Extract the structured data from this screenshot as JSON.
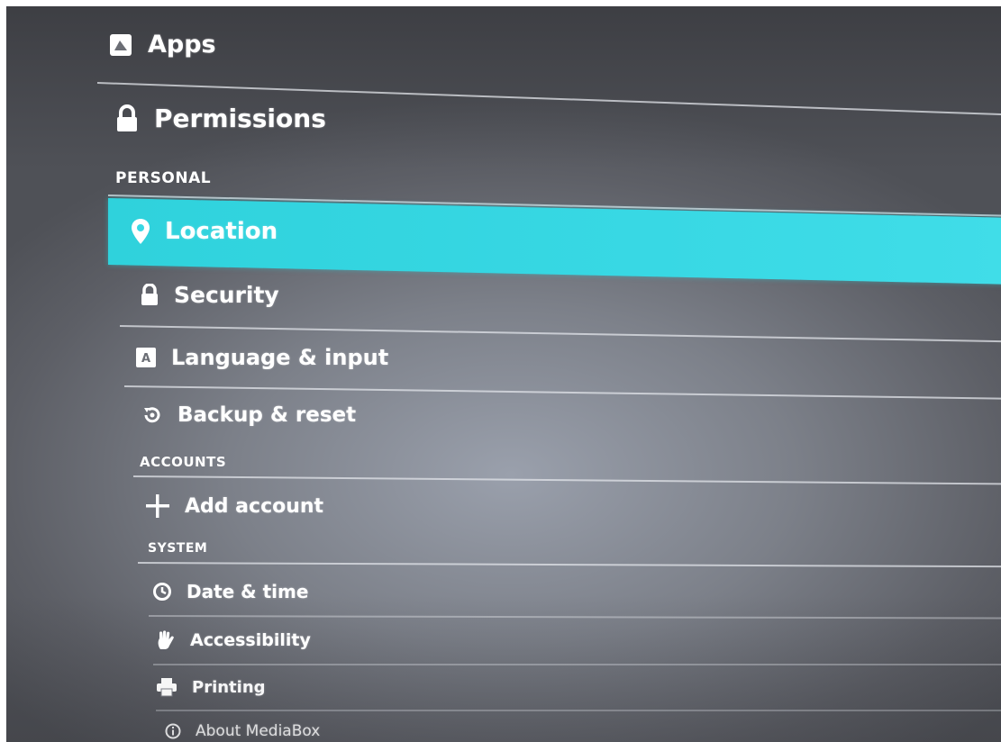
{
  "settings": {
    "apps": {
      "label": "Apps",
      "icon": "apps-icon"
    },
    "permissions": {
      "label": "Permissions",
      "icon": "lock-icon"
    },
    "sections": {
      "personal": "PERSONAL",
      "accounts": "ACCOUNTS",
      "system": "SYSTEM"
    },
    "location": {
      "label": "Location",
      "icon": "location-pin-icon",
      "selected": true
    },
    "security": {
      "label": "Security",
      "icon": "lock-icon"
    },
    "language": {
      "label": "Language & input",
      "icon": "keyboard-icon"
    },
    "backup": {
      "label": "Backup & reset",
      "icon": "backup-restore-icon"
    },
    "add_account": {
      "label": "Add account",
      "icon": "plus-icon"
    },
    "date_time": {
      "label": "Date & time",
      "icon": "clock-icon"
    },
    "accessibility": {
      "label": "Accessibility",
      "icon": "hand-icon"
    },
    "printing": {
      "label": "Printing",
      "icon": "printer-icon"
    },
    "about": {
      "label": "About MediaBox",
      "icon": "info-icon"
    }
  },
  "colors": {
    "highlight": "#38d8e4",
    "text": "#ffffff",
    "background": "#7c8089"
  }
}
